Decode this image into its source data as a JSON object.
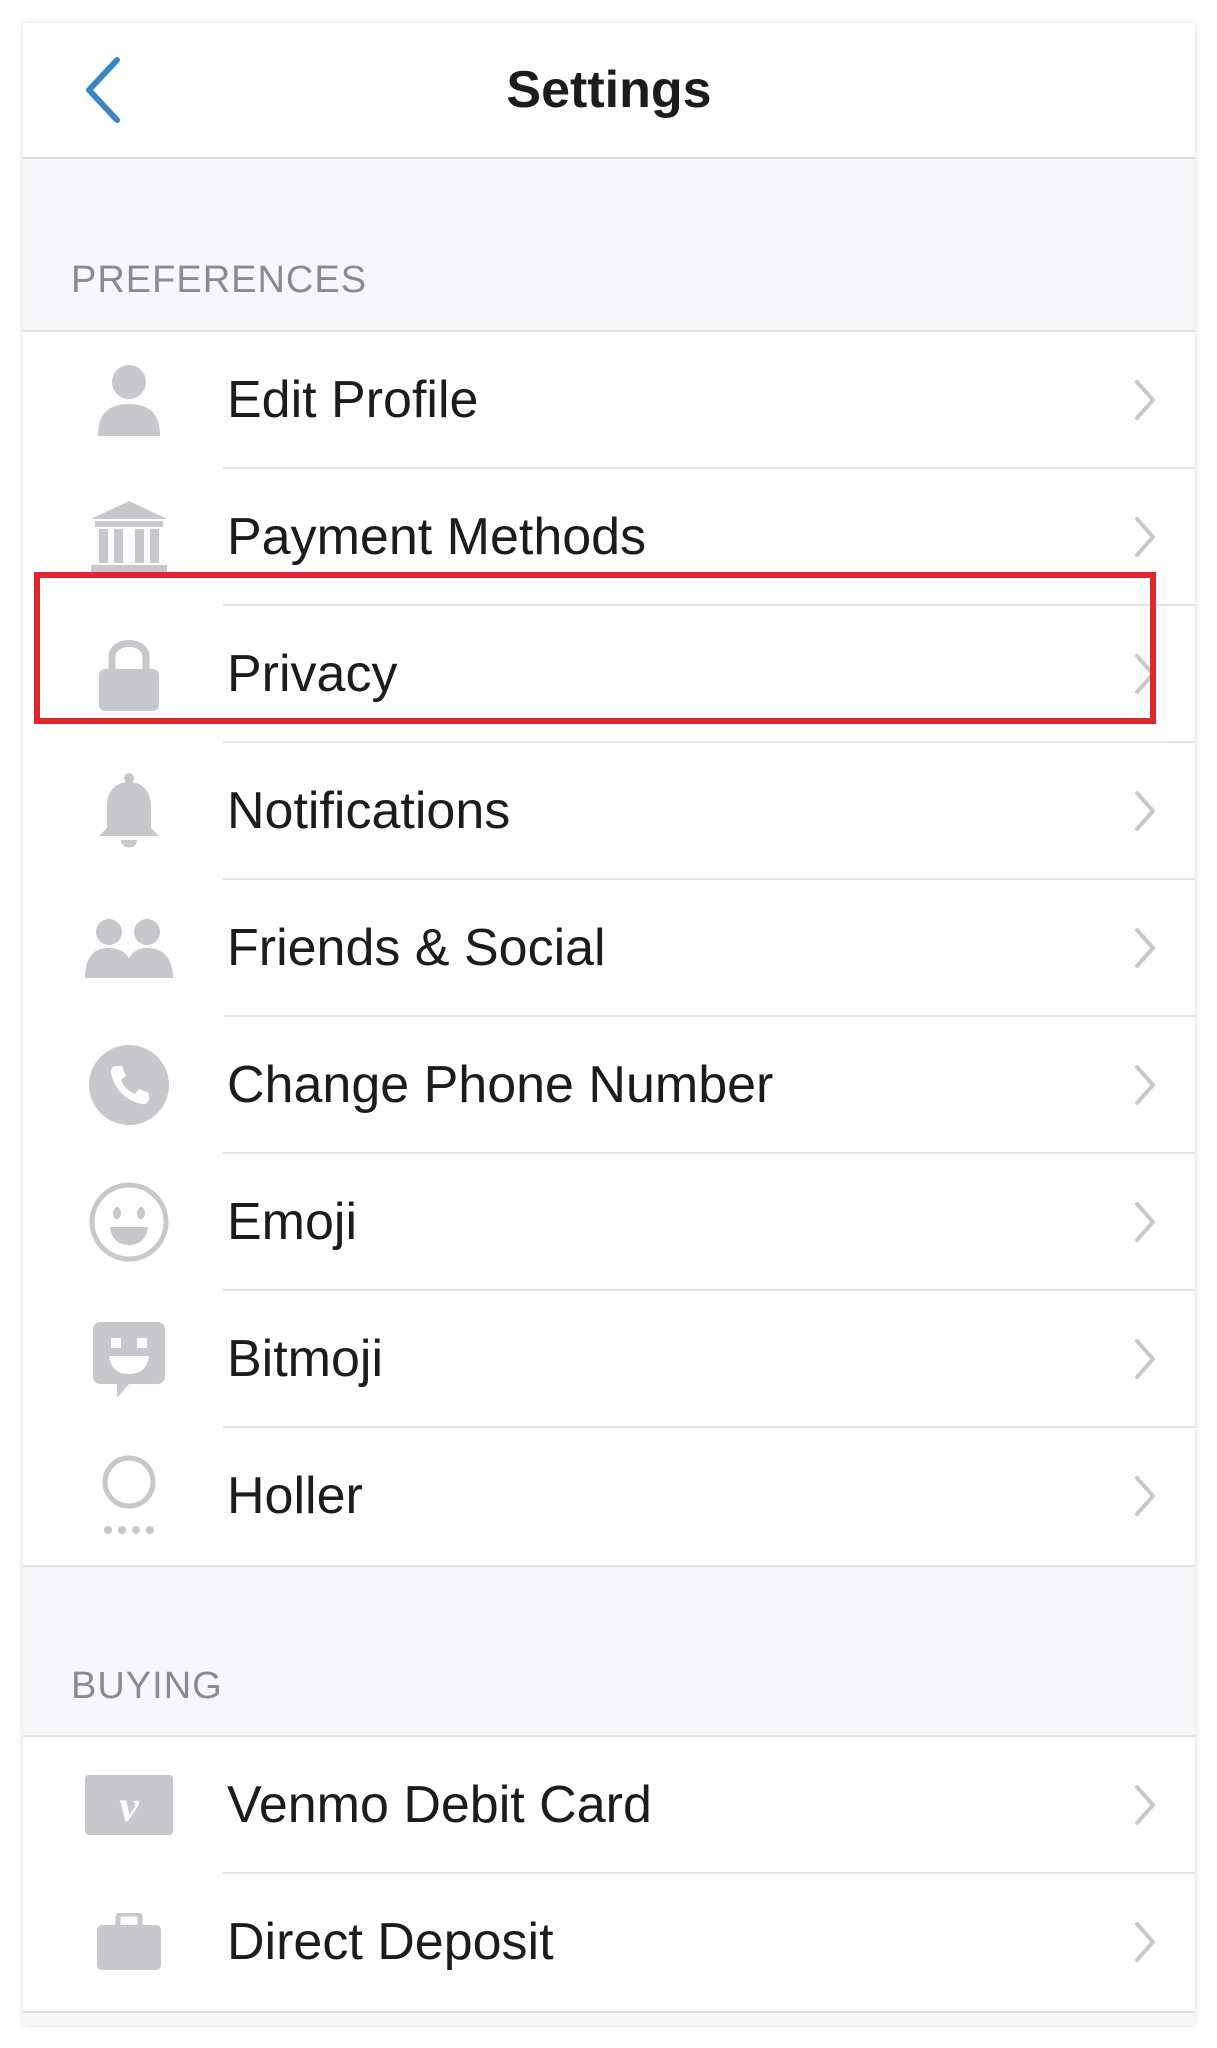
{
  "header": {
    "title": "Settings",
    "back_icon": "chevron-left-icon",
    "back_color": "#3a86c4"
  },
  "sections": {
    "preferences": {
      "title": "PREFERENCES",
      "items": [
        {
          "label": "Edit Profile",
          "icon": "person-icon"
        },
        {
          "label": "Payment Methods",
          "icon": "bank-icon"
        },
        {
          "label": "Privacy",
          "icon": "lock-icon",
          "highlighted": true
        },
        {
          "label": "Notifications",
          "icon": "bell-icon"
        },
        {
          "label": "Friends & Social",
          "icon": "friends-icon"
        },
        {
          "label": "Change Phone Number",
          "icon": "phone-icon"
        },
        {
          "label": "Emoji",
          "icon": "smiley-icon"
        },
        {
          "label": "Bitmoji",
          "icon": "bitmoji-icon"
        },
        {
          "label": "Holler",
          "icon": "holler-icon"
        }
      ]
    },
    "buying": {
      "title": "BUYING",
      "items": [
        {
          "label": "Venmo Debit Card",
          "icon": "venmo-card-icon"
        },
        {
          "label": "Direct Deposit",
          "icon": "briefcase-icon"
        }
      ]
    }
  },
  "colors": {
    "icon_gray": "#c7c7cc",
    "highlight": "#e0252c"
  }
}
